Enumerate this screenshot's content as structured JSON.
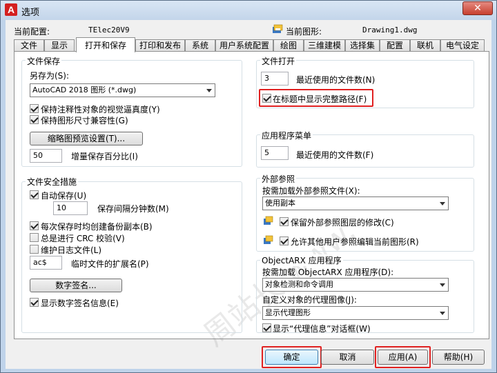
{
  "window": {
    "title": "选项",
    "app_icon_letter": "A",
    "close_label": "✕"
  },
  "header": {
    "config_label": "当前配置:",
    "config_value": "TElec20V9",
    "drawing_label": "当前图形:",
    "drawing_value": "Drawing1.dwg"
  },
  "tabs": [
    {
      "label": "文件"
    },
    {
      "label": "显示"
    },
    {
      "label": "打开和保存",
      "active": true
    },
    {
      "label": "打印和发布"
    },
    {
      "label": "系统"
    },
    {
      "label": "用户系统配置"
    },
    {
      "label": "绘图"
    },
    {
      "label": "三维建模"
    },
    {
      "label": "选择集"
    },
    {
      "label": "配置"
    },
    {
      "label": "联机"
    },
    {
      "label": "电气设定"
    }
  ],
  "file_save": {
    "title": "文件保存",
    "save_as_label": "另存为(S):",
    "save_as_value": "AutoCAD 2018 图形 (*.dwg)",
    "keep_annotative": {
      "label": "保持注释性对象的视觉逼真度(Y)",
      "checked": true
    },
    "keep_size": {
      "label": "保持图形尺寸兼容性(G)",
      "checked": true
    },
    "thumbnail_button": "缩略图预览设置(T)...",
    "incremental_value": "50",
    "incremental_label": "增量保存百分比(I)"
  },
  "file_safety": {
    "title": "文件安全措施",
    "autosave": {
      "label": "自动保存(U)",
      "checked": true
    },
    "interval_value": "10",
    "interval_label": "保存间隔分钟数(M)",
    "backup": {
      "label": "每次保存时均创建备份副本(B)",
      "checked": true
    },
    "crc": {
      "label": "总是进行 CRC 校验(V)",
      "checked": false
    },
    "log": {
      "label": "维护日志文件(L)",
      "checked": false
    },
    "temp_ext_value": "ac$",
    "temp_ext_label": "临时文件的扩展名(P)",
    "digital_sign_button": "数字签名...",
    "show_sign_info": {
      "label": "显示数字签名信息(E)",
      "checked": true
    }
  },
  "file_open": {
    "title": "文件打开",
    "recent_value": "3",
    "recent_label": "最近使用的文件数(N)",
    "full_path": {
      "label": "在标题中显示完整路径(F)",
      "checked": true
    }
  },
  "app_menu": {
    "title": "应用程序菜单",
    "recent_value": "5",
    "recent_label": "最近使用的文件数(F)"
  },
  "xref": {
    "title": "外部参照",
    "demand_load_label": "按需加载外部参照文件(X):",
    "demand_load_value": "使用副本",
    "retain_layers": {
      "label": "保留外部参照图层的修改(C)",
      "checked": true
    },
    "allow_edit": {
      "label": "允许其他用户参照编辑当前图形(R)",
      "checked": true
    }
  },
  "objectarx": {
    "title": "ObjectARX 应用程序",
    "demand_load_label": "按需加载 ObjectARX 应用程序(D):",
    "demand_load_value": "对象检测和命令调用",
    "proxy_label": "自定义对象的代理图像(J):",
    "proxy_value": "显示代理图形",
    "show_proxy_dialog": {
      "label": "显示“代理信息”对话框(W)",
      "checked": true
    }
  },
  "buttons": {
    "ok": "确定",
    "cancel": "取消",
    "apply": "应用(A)",
    "help": "帮助(H)"
  },
  "watermark": "周站长 www.",
  "colors": {
    "highlight": "#e02020",
    "title_bar": "#c3d5ea",
    "close_button": "#c7402f"
  }
}
